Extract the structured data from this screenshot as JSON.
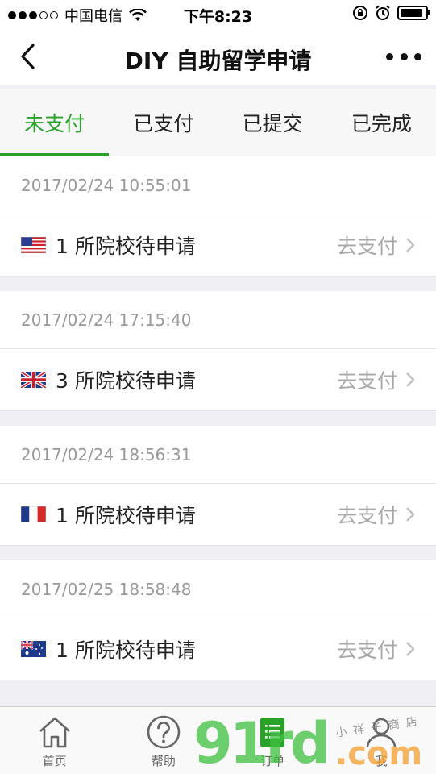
{
  "status_bar": {
    "carrier": "中国电信",
    "time": "下午8:23",
    "battery_level": 0.9
  },
  "nav": {
    "title": "DIY 自助留学申请",
    "back_icon": "chevron-left-icon",
    "more_icon": "more-dots-icon"
  },
  "tabs": [
    {
      "label": "未支付",
      "active": true
    },
    {
      "label": "已支付",
      "active": false
    },
    {
      "label": "已提交",
      "active": false
    },
    {
      "label": "已完成",
      "active": false
    }
  ],
  "orders": [
    {
      "date": "2017/02/24 10:55:01",
      "flag": "us-flag-icon",
      "text": "1 所院校待申请",
      "action": "去支付"
    },
    {
      "date": "2017/02/24 17:15:40",
      "flag": "uk-flag-icon",
      "text": "3 所院校待申请",
      "action": "去支付"
    },
    {
      "date": "2017/02/24 18:56:31",
      "flag": "fr-flag-icon",
      "text": "1 所院校待申请",
      "action": "去支付"
    },
    {
      "date": "2017/02/25 18:58:48",
      "flag": "au-flag-icon",
      "text": "1 所院校待申请",
      "action": "去支付"
    }
  ],
  "tabbar": [
    {
      "label": "首页",
      "icon": "home-icon"
    },
    {
      "label": "帮助",
      "icon": "help-icon"
    },
    {
      "label": "订单",
      "icon": "orders-icon"
    },
    {
      "label": "我",
      "icon": "user-icon"
    }
  ],
  "watermark": {
    "main": "91rd",
    "suffix": ".com",
    "small": "小祥子商店"
  },
  "colors": {
    "accent": "#2aa22a",
    "muted_text": "#999999",
    "action_text": "#a8a8a8"
  }
}
